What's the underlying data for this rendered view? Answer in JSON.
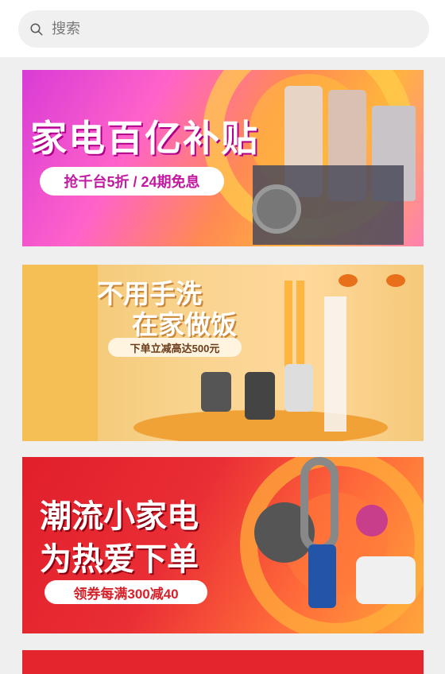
{
  "search": {
    "placeholder": "搜索"
  },
  "banners": [
    {
      "title": "家电百亿补贴",
      "promo": "抢千台5折 / 24期免息"
    },
    {
      "title_line1": "不用手洗",
      "title_line2": "在家做饭",
      "promo": "下单立减高达500元"
    },
    {
      "title_line1": "潮流小家电",
      "title_line2": "为热爱下单",
      "promo": "领券每满300减40"
    }
  ],
  "colors": {
    "accent_pink": "#ff3aa0",
    "accent_red": "#e5252e",
    "accent_gold": "#f8d38d"
  }
}
